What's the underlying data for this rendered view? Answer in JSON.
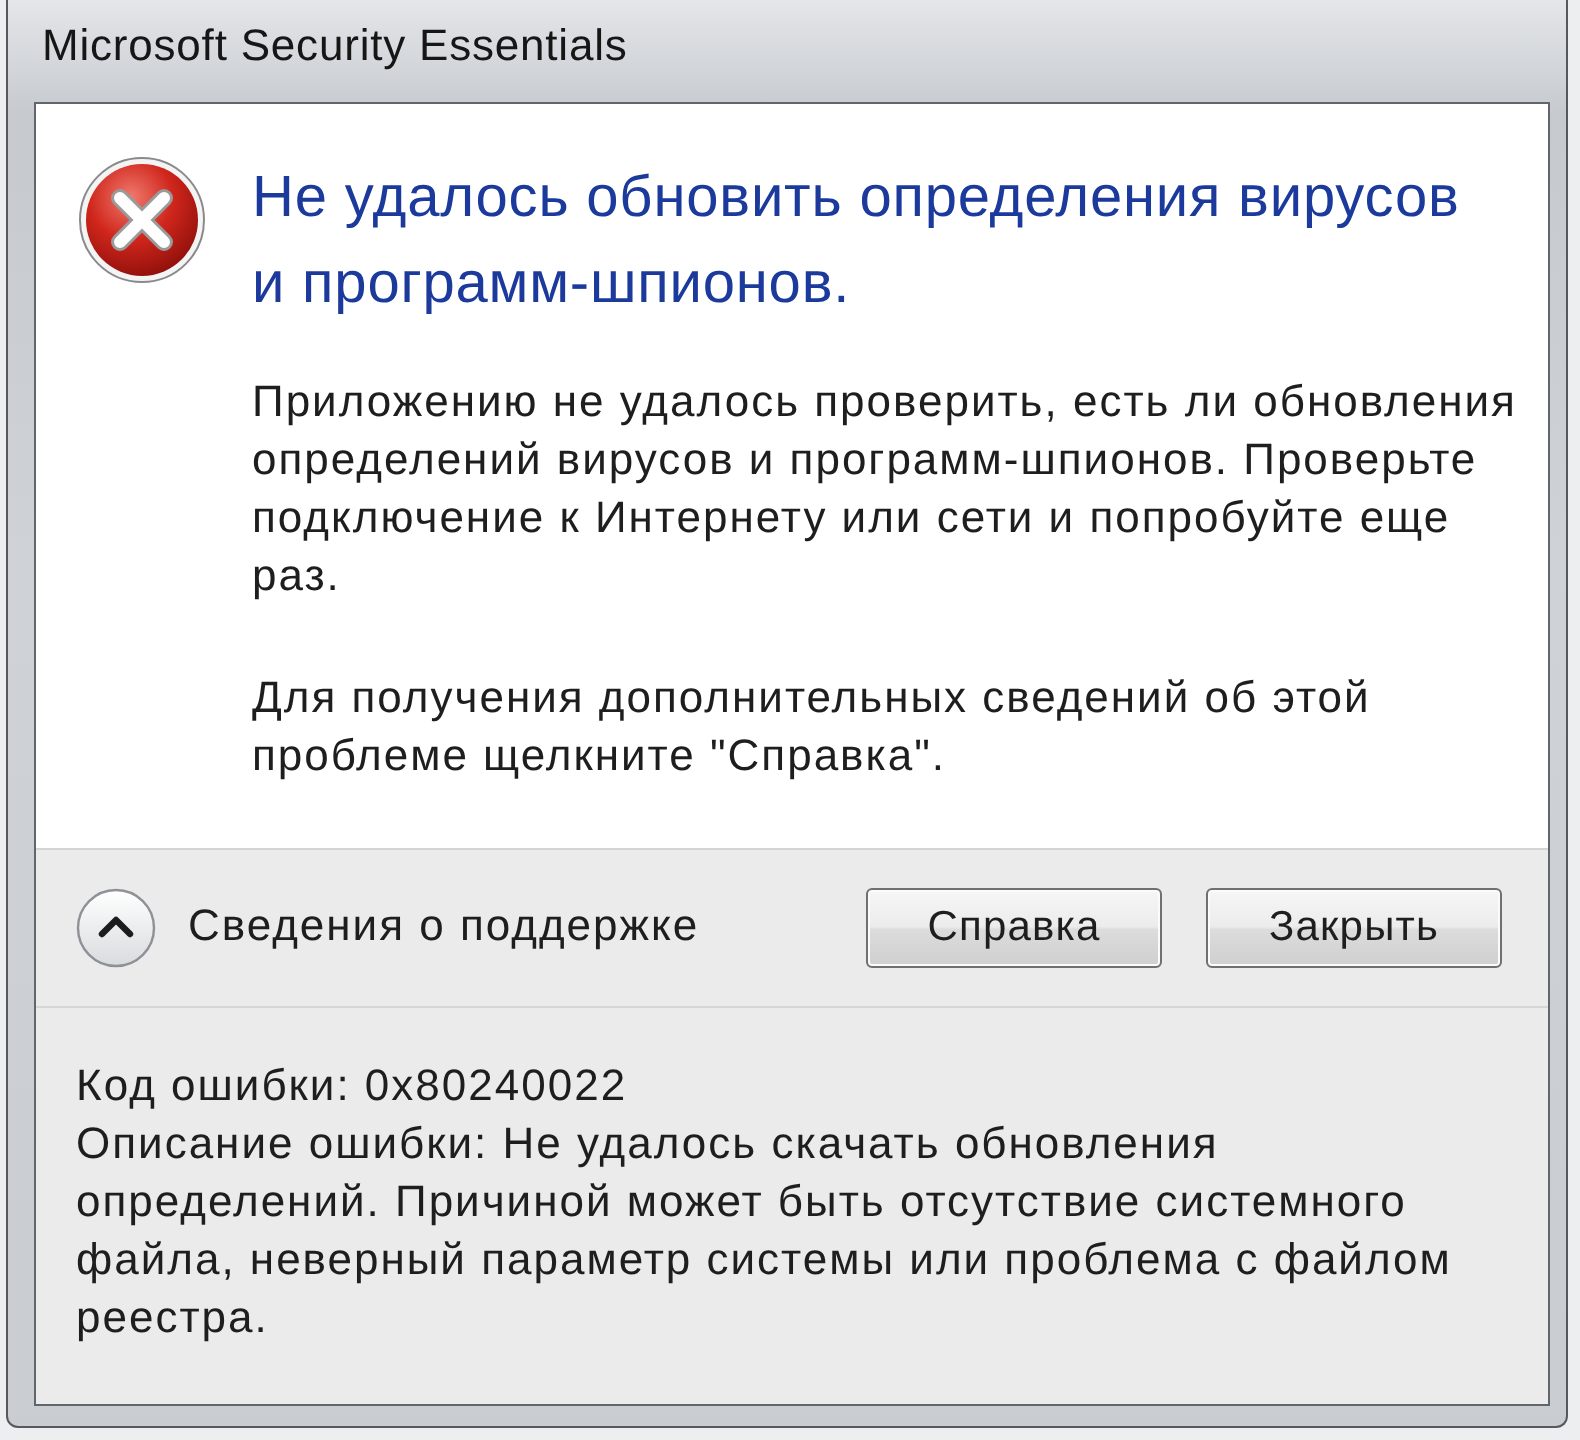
{
  "window": {
    "title": "Microsoft Security Essentials"
  },
  "message": {
    "heading": "Не удалось обновить определения вирусов и программ-шпионов.",
    "paragraphs": [
      "Приложению не удалось проверить, есть ли обновления определений вирусов и программ-шпионов. Проверьте подключение к Интернету или сети и попробуйте еще раз.",
      "Для получения дополнительных сведений об этой проблеме щелкните \"Справка\"."
    ]
  },
  "details_toggle": {
    "label": "Сведения о поддержке",
    "expanded": true
  },
  "buttons": [
    {
      "label": "Справка"
    },
    {
      "label": "Закрыть"
    }
  ],
  "details": {
    "lines": [
      "Код ошибки: 0x80240022",
      "Описание ошибки: Не удалось скачать обновления определений. Причиной может быть отсутствие системного файла, неверный параметр системы или проблема с файлом реестра."
    ]
  }
}
